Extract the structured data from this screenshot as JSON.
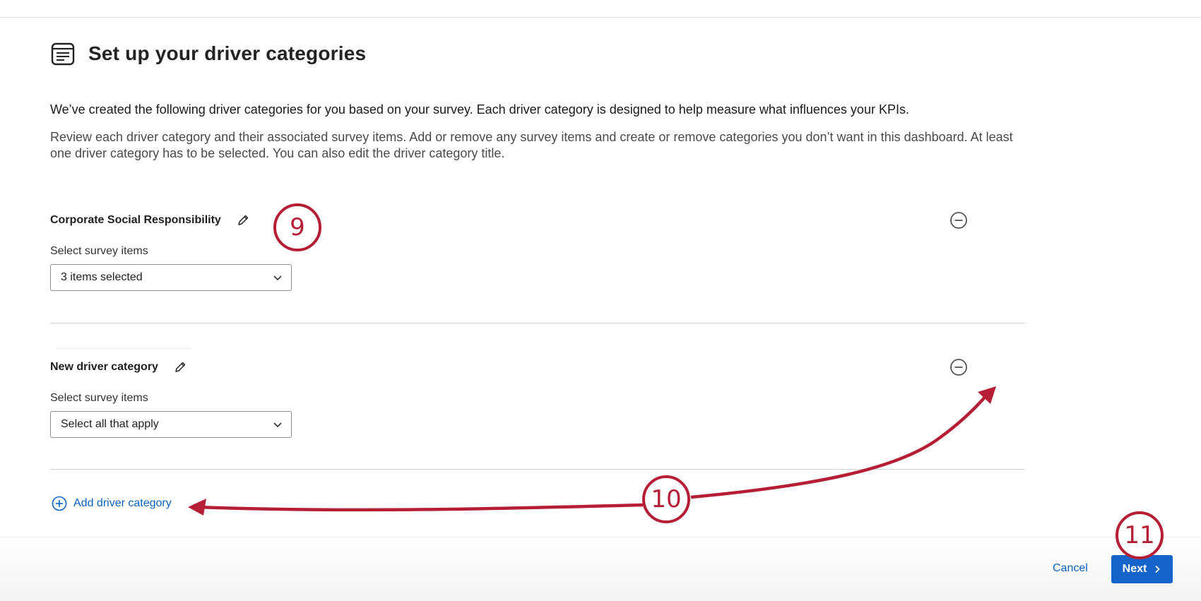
{
  "page": {
    "title": "Set up your driver categories",
    "description_primary": "We’ve created the following driver categories for you based on your survey. Each driver category is designed to help measure what influences your KPIs.",
    "description_secondary": "Review each driver category and their associated survey items. Add or remove any survey items and create or remove categories you don’t want in this dashboard. At least one driver category has to be selected. You can also edit the driver category title."
  },
  "categories": [
    {
      "title": "Corporate Social Responsibility",
      "select_label": "Select survey items",
      "dropdown_value": "3 items selected"
    },
    {
      "title": "New driver category",
      "select_label": "Select survey items",
      "dropdown_value": "Select all that apply"
    }
  ],
  "actions": {
    "add_category_label": "Add driver category",
    "cancel_label": "Cancel",
    "next_label": "Next"
  },
  "callouts": {
    "step_9": "9",
    "step_10": "10",
    "step_11": "11"
  },
  "colors": {
    "accent_blue": "#1464cc",
    "link_blue": "#0b62c4",
    "annotation_red": "#b61e35"
  }
}
